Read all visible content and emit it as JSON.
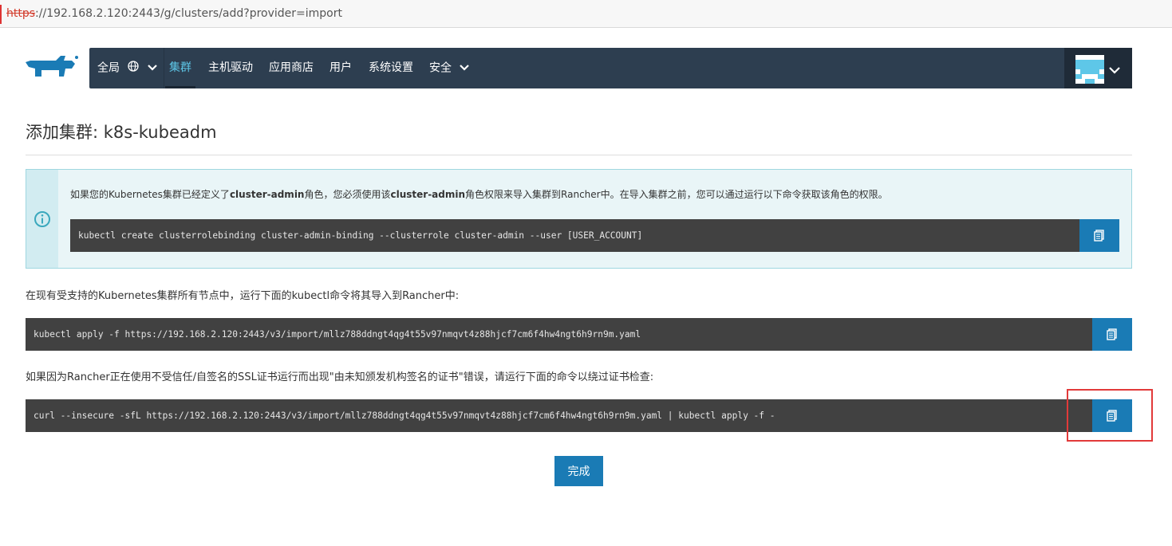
{
  "browser": {
    "url_protocol": "https",
    "url_rest": "://192.168.2.120:2443/g/clusters/add?provider=import"
  },
  "nav": {
    "global_label": "全局",
    "items": [
      {
        "label": "集群",
        "active": true
      },
      {
        "label": "主机驱动"
      },
      {
        "label": "应用商店"
      },
      {
        "label": "用户"
      },
      {
        "label": "系统设置"
      },
      {
        "label": "安全"
      }
    ],
    "icons": {
      "global": "globe-icon",
      "dropdown": "chevron-down-icon"
    }
  },
  "page": {
    "title": "添加集群: k8s-kubeadm"
  },
  "banner": {
    "text_1": "如果您的Kubernetes集群已经定义了",
    "bold_1": "cluster-admin",
    "text_2": "角色，您必须使用该",
    "bold_2": "cluster-admin",
    "text_3": "角色权限来导入集群到Rancher中。在导入集群之前，您可以通过运行以下命令获取该角色的权限。",
    "command": "kubectl create clusterrolebinding cluster-admin-binding --clusterrole cluster-admin --user [USER_ACCOUNT]",
    "icon": "info-icon"
  },
  "instructions": {
    "kubectl_text": "在现有受支持的Kubernetes集群所有节点中，运行下面的kubectl命令将其导入到Rancher中:",
    "kubectl_command": "kubectl apply -f https://192.168.2.120:2443/v3/import/mllz788ddngt4qg4t55v97nmqvt4z88hjcf7cm6f4hw4ngt6h9rn9m.yaml",
    "insecure_text": "如果因为Rancher正在使用不受信任/自签名的SSL证书运行而出现\"由未知颁发机构签名的证书\"错误，请运行下面的命令以绕过证书检查:",
    "insecure_command": "curl --insecure -sfL https://192.168.2.120:2443/v3/import/mllz788ddngt4qg4t55v97nmqvt4z88hjcf7cm6f4hw4ngt6h9rn9m.yaml | kubectl apply -f -"
  },
  "actions": {
    "done_label": "完成",
    "copy_icon": "clipboard-icon"
  },
  "colors": {
    "nav_bg": "#2d3e50",
    "accent": "#1a7bb5",
    "active_nav": "#5ec7e8",
    "highlight": "#e23a3a"
  }
}
